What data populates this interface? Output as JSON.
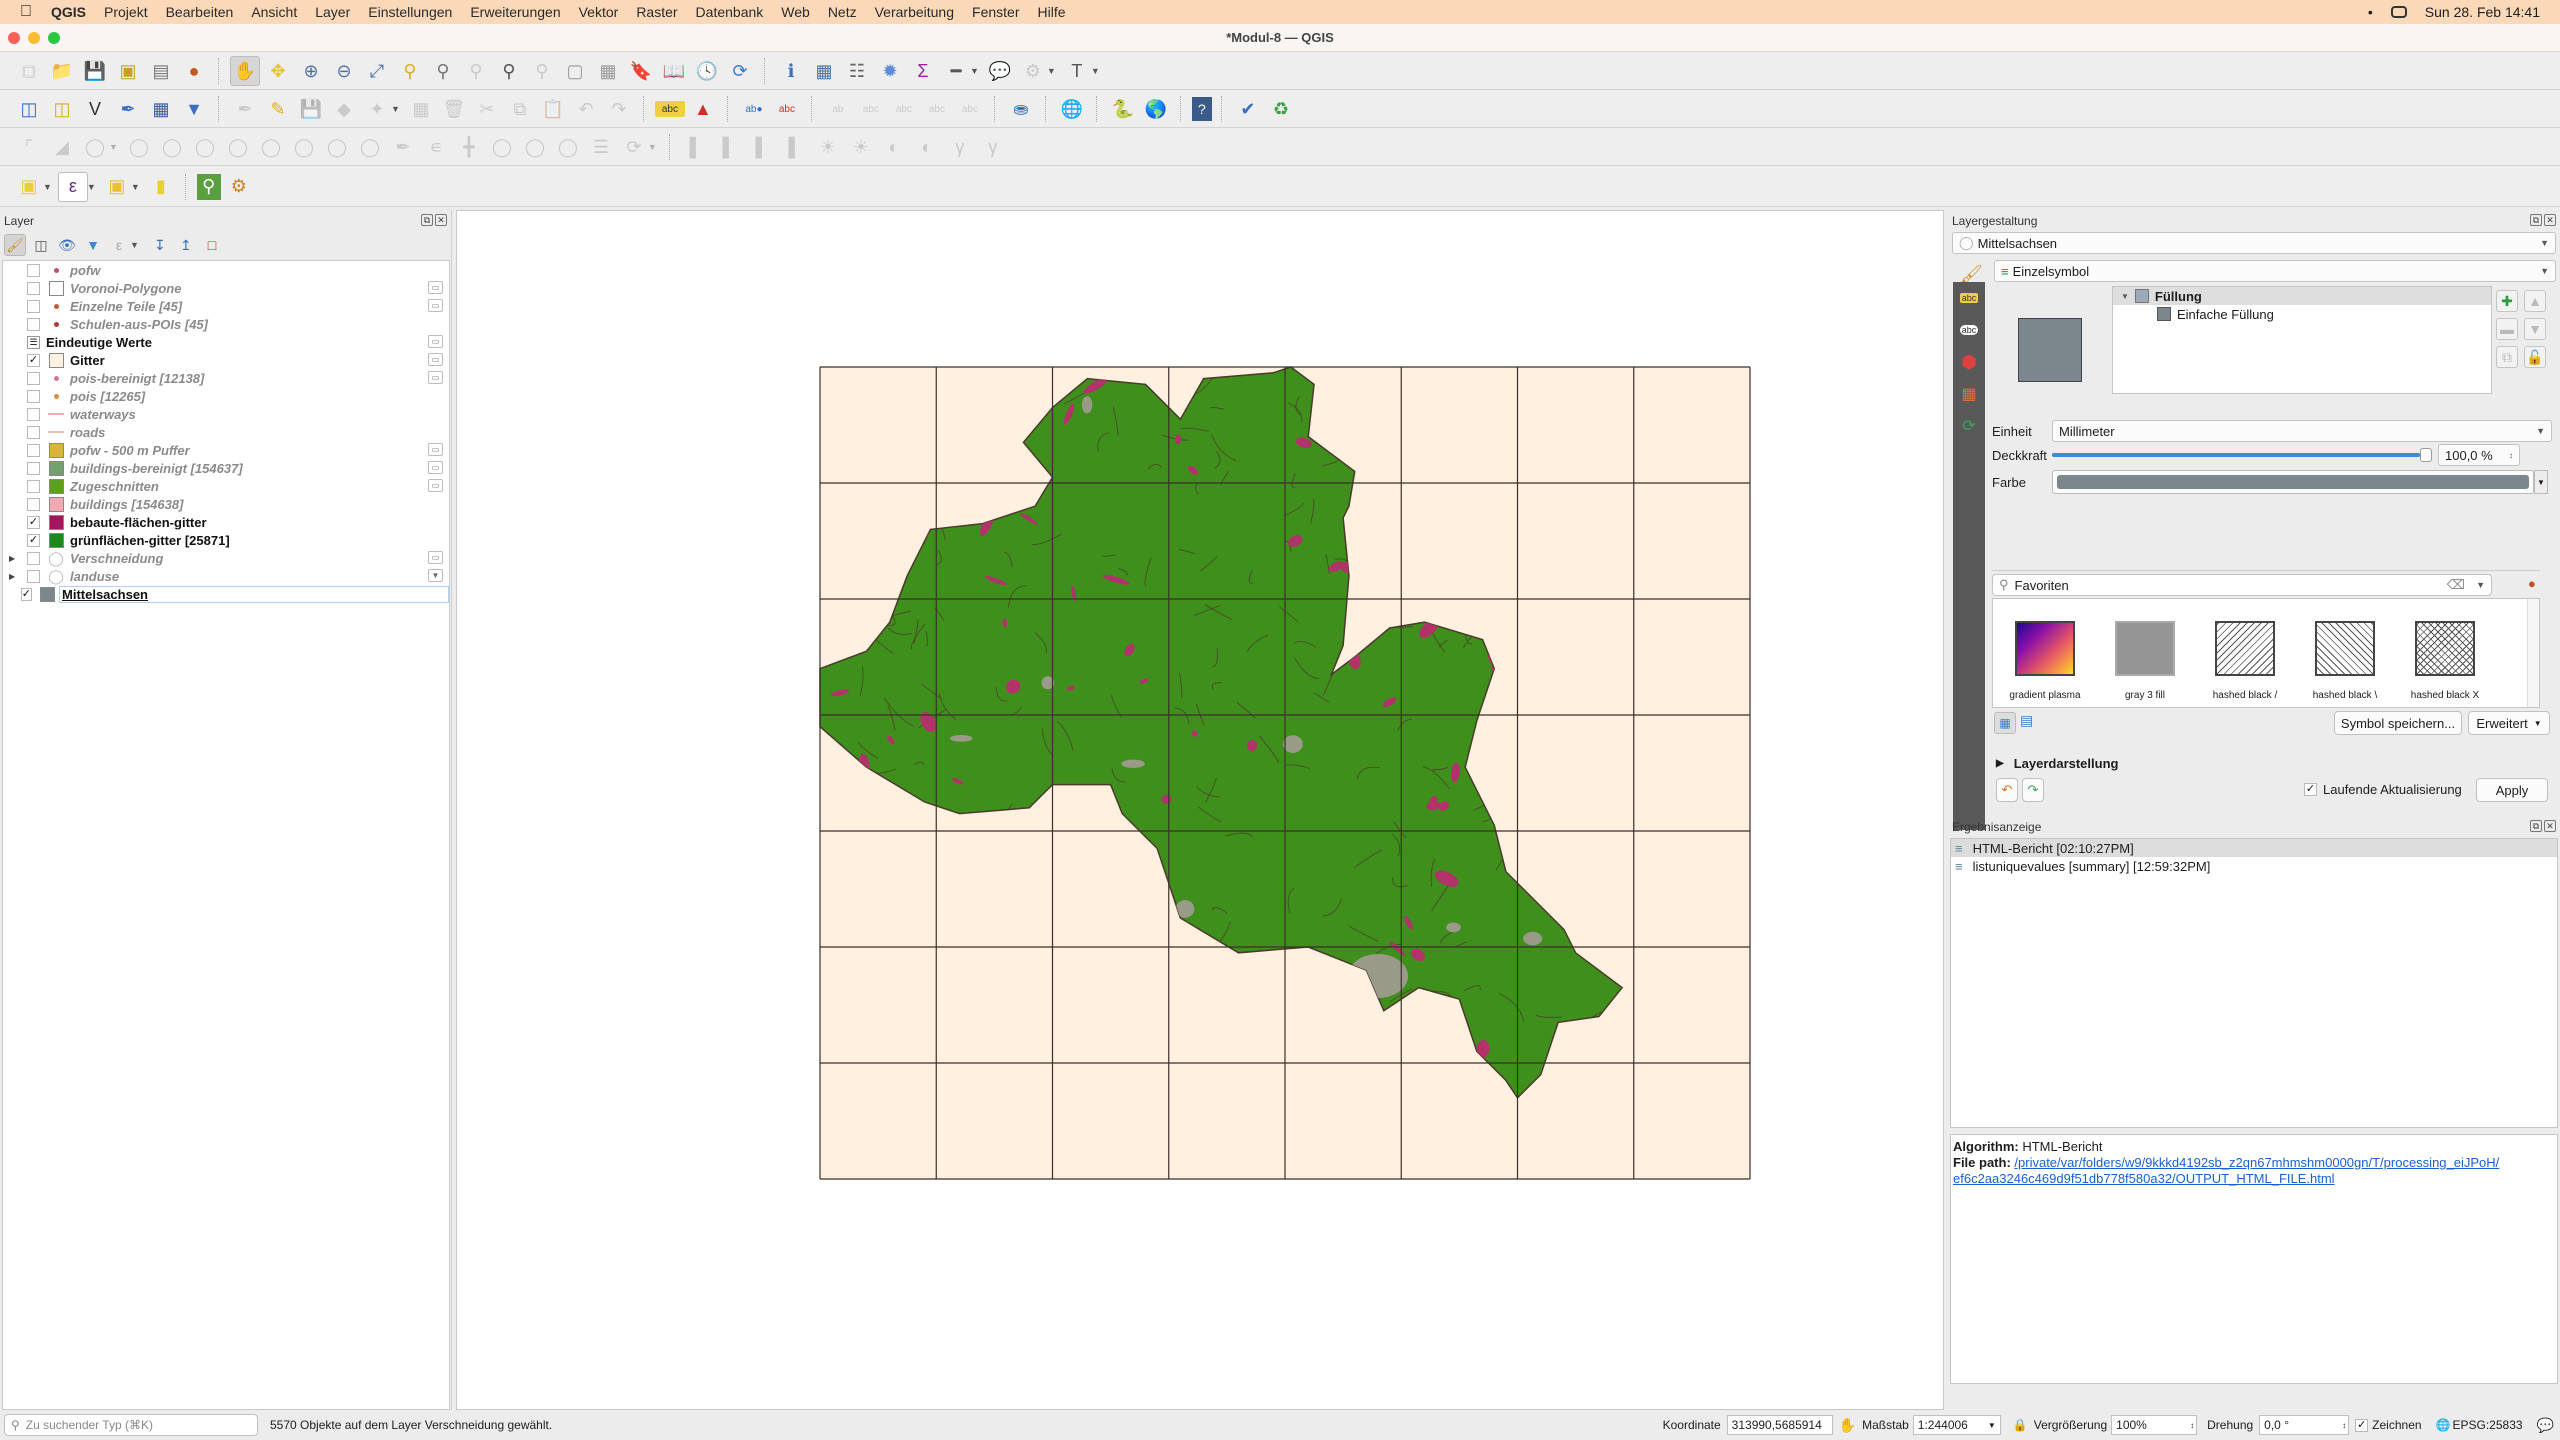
{
  "menubar": {
    "app_name": "QGIS",
    "items": [
      "Projekt",
      "Bearbeiten",
      "Ansicht",
      "Layer",
      "Einstellungen",
      "Erweiterungen",
      "Vektor",
      "Raster",
      "Datenbank",
      "Web",
      "Netz",
      "Verarbeitung",
      "Fenster",
      "Hilfe"
    ],
    "clock": "Sun 28. Feb  14:41"
  },
  "window": {
    "title": "*Modul-8 — QGIS"
  },
  "toolbars": {
    "row1": [
      "new-project",
      "open-project",
      "save-project",
      "print-layout",
      "layout-manager",
      "style-manager",
      "pan",
      "pan-to-selection",
      "zoom-in",
      "zoom-out",
      "zoom-full",
      "zoom-to-selection",
      "zoom-to-layer",
      "zoom-native",
      "zoom-last",
      "zoom-next",
      "new-bookmark",
      "show-bookmarks",
      "spatial-bookmarks",
      "map-tips",
      "temporal",
      "refresh",
      "identify",
      "attribute-table",
      "statistics",
      "settings",
      "sum",
      "measure",
      "annotation",
      "decorations",
      "text-annotation"
    ],
    "row2": [
      "data-source-manager",
      "new-geopackage",
      "new-shapefile",
      "digitize",
      "virtual-layer",
      "mesh",
      "toggle-edit",
      "pencil",
      "save-edits",
      "add-feature",
      "vertex-tool",
      "node",
      "delete",
      "cut",
      "copy",
      "paste",
      "undo",
      "redo",
      "label",
      "diagram",
      "label-pin",
      "label-highlight",
      "show-labels",
      "hide-label",
      "move-label",
      "rotate-label",
      "change-label",
      "db-manager",
      "metasearch",
      "python",
      "globe",
      "help",
      "georef",
      "table-refresh"
    ],
    "row3": [
      "digitize-tools"
    ],
    "row4": [
      "select-features",
      "select-by-expression",
      "deselect",
      "select-by-location",
      "locator",
      "processing-toolbox"
    ]
  },
  "layers_panel": {
    "title": "Layer",
    "layers": [
      {
        "name": "pofw",
        "checked": false,
        "visible": false,
        "symbol": "point",
        "color": "#c0506a",
        "indicator": false
      },
      {
        "name": "Voronoi-Polygone",
        "checked": false,
        "visible": false,
        "symbol": "fill",
        "color": "#ffffff",
        "indicator": true
      },
      {
        "name": "Einzelne Teile [45]",
        "checked": false,
        "visible": false,
        "symbol": "point",
        "color": "#c65a3a",
        "indicator": true
      },
      {
        "name": "Schulen-aus-POIs [45]",
        "checked": false,
        "visible": false,
        "symbol": "point",
        "color": "#b43a3a",
        "indicator": false
      },
      {
        "name": "Eindeutige Werte",
        "checked": null,
        "visible": true,
        "symbol": "table",
        "color": "",
        "indicator": true
      },
      {
        "name": "Gitter",
        "checked": true,
        "visible": true,
        "symbol": "fill",
        "color": "#fff0e0",
        "indicator": true
      },
      {
        "name": "pois-bereinigt [12138]",
        "checked": false,
        "visible": false,
        "symbol": "point",
        "color": "#d07a90",
        "indicator": true
      },
      {
        "name": "pois [12265]",
        "checked": false,
        "visible": false,
        "symbol": "point",
        "color": "#e08a3a",
        "indicator": false
      },
      {
        "name": "waterways",
        "checked": false,
        "visible": false,
        "symbol": "line",
        "color": "#e8b0b0",
        "indicator": false
      },
      {
        "name": "roads",
        "checked": false,
        "visible": false,
        "symbol": "line",
        "color": "#f0c0b8",
        "indicator": false
      },
      {
        "name": "pofw - 500 m Puffer",
        "checked": false,
        "visible": false,
        "symbol": "fill",
        "color": "#d8b43a",
        "indicator": true
      },
      {
        "name": "buildings-bereinigt [154637]",
        "checked": false,
        "visible": false,
        "symbol": "fill",
        "color": "#74a070",
        "indicator": true
      },
      {
        "name": "Zugeschnitten",
        "checked": false,
        "visible": false,
        "symbol": "fill",
        "color": "#5aa01a",
        "indicator": true
      },
      {
        "name": "buildings [154638]",
        "checked": false,
        "visible": false,
        "symbol": "fill",
        "color": "#f4a8b4",
        "indicator": false
      },
      {
        "name": "bebaute-flächen-gitter",
        "checked": true,
        "visible": true,
        "symbol": "fill",
        "color": "#a0175e",
        "indicator": false
      },
      {
        "name": "grünflächen-gitter [25871]",
        "checked": true,
        "visible": true,
        "symbol": "fill",
        "color": "#1a8a1a",
        "indicator": false
      },
      {
        "name": "Verschneidung",
        "checked": false,
        "visible": false,
        "symbol": "group",
        "color": "",
        "indicator": true,
        "expandable": true
      },
      {
        "name": "landuse",
        "checked": false,
        "visible": false,
        "symbol": "group",
        "color": "",
        "indicator": "filter",
        "expandable": true
      },
      {
        "name": "Mittelsachsen",
        "checked": true,
        "visible": true,
        "symbol": "fill",
        "color": "#7b878d",
        "indicator": false,
        "selected": true
      }
    ]
  },
  "map": {
    "grid_cols": 8,
    "grid_rows": 7,
    "grid_fill": "#fff0e0",
    "green": "#3f8f1c",
    "built": "#b2336a",
    "gray": "#9a9a88",
    "outline": "#4a3a2a"
  },
  "styling_panel": {
    "title": "Layergestaltung",
    "layer": "Mittelsachsen",
    "renderer": "Einzelsymbol",
    "symbol_tree": {
      "root": "Füllung",
      "child": "Einfache Füllung"
    },
    "symbol_color": "#7b878d",
    "unit_label": "Einheit",
    "unit_value": "Millimeter",
    "opacity_label": "Deckkraft",
    "opacity_value": "100,0 %",
    "opacity_fraction": 1.0,
    "color_label": "Farbe",
    "search_value": "Favoriten",
    "favorites": [
      {
        "label": "gradient   plasma",
        "type": "gradient"
      },
      {
        "label": "gray 3 fill",
        "type": "gray"
      },
      {
        "label": "hashed black /",
        "type": "hatch-fwd"
      },
      {
        "label": "hashed black \\",
        "type": "hatch-back"
      },
      {
        "label": "hashed black X",
        "type": "hatch-x"
      }
    ],
    "save_symbol_label": "Symbol speichern...",
    "advanced_label": "Erweitert",
    "layer_rendering_label": "Layerdarstellung",
    "live_update_label": "Laufende Aktualisierung",
    "live_update_checked": true,
    "apply_label": "Apply"
  },
  "results_panel": {
    "title": "Ergebnisanzeige",
    "items": [
      "HTML-Bericht [02:10:27PM]",
      "listuniquevalues [summary] [12:59:32PM]"
    ],
    "algorithm_label": "Algorithm:",
    "algorithm_value": " HTML-Bericht",
    "filepath_label": "File path:",
    "filepath_line1": "/private/var/folders/w9/9kkkd4192sb_z2qn67mhmshm0000gn/T/processing_eiJPoH/",
    "filepath_line2": "ef6c2aa3246c469d9f51db778f580a32/OUTPUT_HTML_FILE.html"
  },
  "statusbar": {
    "search_placeholder": "Zu suchender Typ (⌘K)",
    "message": "5570 Objekte auf dem Layer Verschneidung gewählt.",
    "coord_label": "Koordinate",
    "coord_value": "313990,5685914",
    "scale_label": "Maßstab",
    "scale_value": "1:244006",
    "magnifier_label": "Vergrößerung",
    "magnifier_value": "100%",
    "rotation_label": "Drehung",
    "rotation_value": "0,0 °",
    "render_label": "Zeichnen",
    "render_checked": true,
    "crs": "EPSG:25833"
  }
}
